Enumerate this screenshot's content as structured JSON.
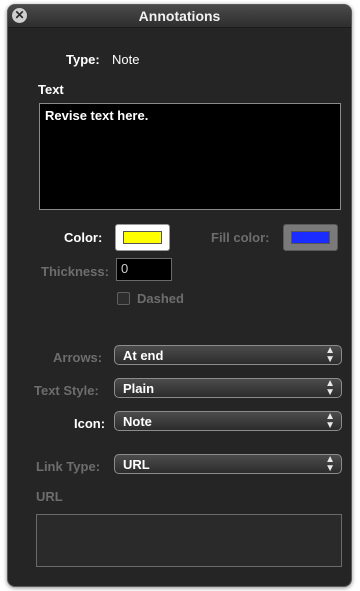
{
  "window": {
    "title": "Annotations"
  },
  "type_row": {
    "label": "Type:",
    "value": "Note"
  },
  "text_section": {
    "label": "Text",
    "content": "Revise text here."
  },
  "color": {
    "label": "Color:",
    "value": "#ffff00"
  },
  "fill_color": {
    "label": "Fill color:",
    "value": "#1a2cff"
  },
  "thickness": {
    "label": "Thickness:",
    "value": "0"
  },
  "dashed": {
    "label": "Dashed",
    "checked": false
  },
  "arrows": {
    "label": "Arrows:",
    "value": "At end"
  },
  "text_style": {
    "label": "Text Style:",
    "value": "Plain"
  },
  "icon": {
    "label": "Icon:",
    "value": "Note"
  },
  "link_type": {
    "label": "Link Type:",
    "value": "URL"
  },
  "url": {
    "label": "URL",
    "value": ""
  }
}
